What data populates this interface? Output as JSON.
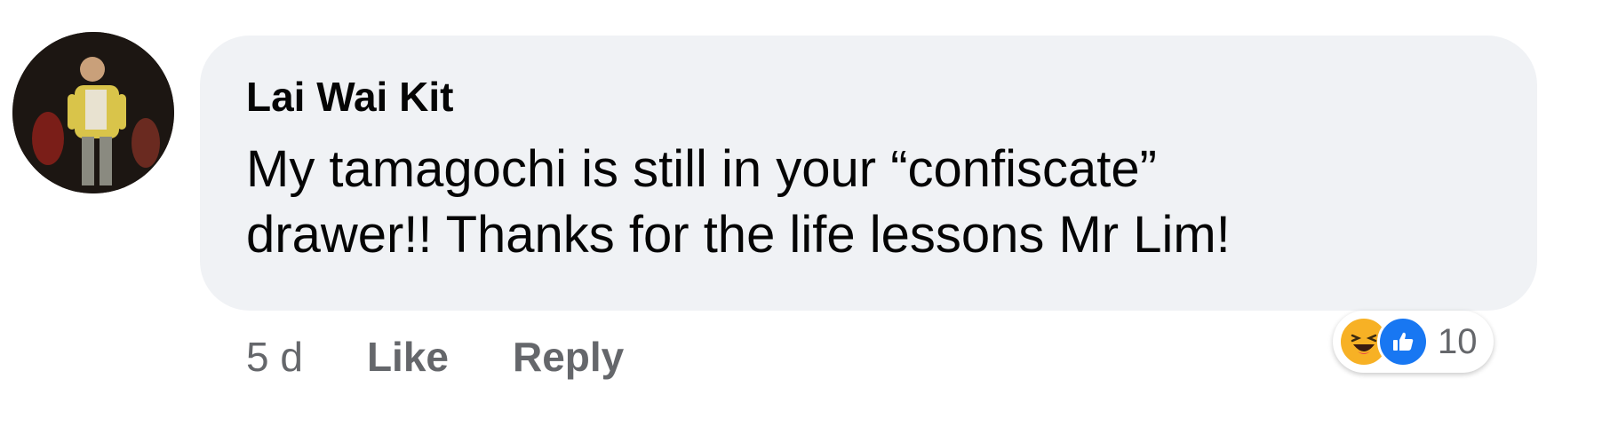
{
  "comment": {
    "author": "Lai Wai Kit",
    "text_lines": [
      "My tamagochi is still in your “confiscate”",
      "drawer!! Thanks for the life lessons Mr Lim!"
    ],
    "timestamp": "5 d",
    "like_label": "Like",
    "reply_label": "Reply",
    "reactions": {
      "icons": [
        "haha-reaction-icon",
        "like-reaction-icon"
      ],
      "count": "10"
    }
  },
  "colors": {
    "bubble_bg": "#f0f2f5",
    "text": "#050505",
    "secondary_text": "#65676b",
    "like_blue": "#1877f2",
    "haha_yellow": "#f7b125"
  }
}
